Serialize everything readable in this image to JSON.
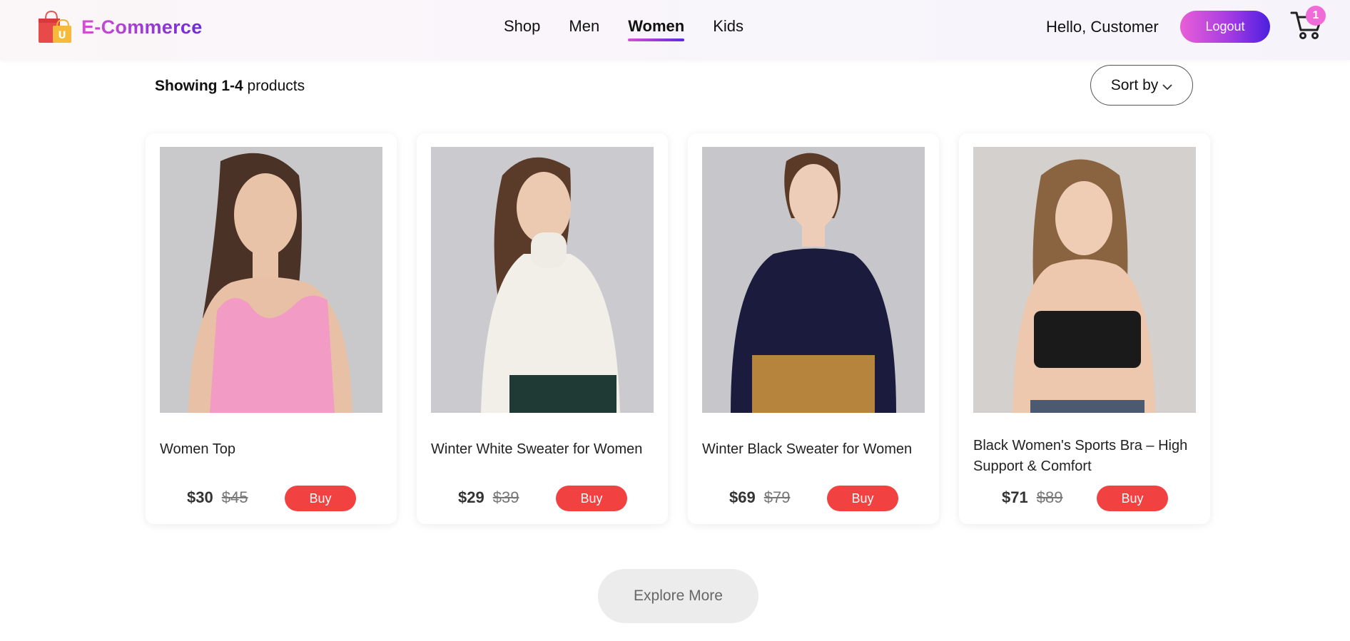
{
  "header": {
    "brand": "E-Commerce",
    "nav": [
      {
        "label": "Shop"
      },
      {
        "label": "Men"
      },
      {
        "label": "Women"
      },
      {
        "label": "Kids"
      }
    ],
    "active_nav": "Women",
    "greeting": "Hello, Customer",
    "logout_label": "Logout",
    "cart_count": "1"
  },
  "toolbar": {
    "showing_prefix": "Showing",
    "showing_range": "1-4",
    "showing_suffix": "products",
    "sort_label": "Sort by"
  },
  "products": [
    {
      "title": "Women Top",
      "price": "$30",
      "old_price": "$45",
      "buy_label": "Buy",
      "image": "woman-pink-top-photo"
    },
    {
      "title": "Winter White Sweater for Women",
      "price": "$29",
      "old_price": "$39",
      "buy_label": "Buy",
      "image": "woman-white-turtleneck-photo"
    },
    {
      "title": "Winter Black Sweater for Women",
      "price": "$69",
      "old_price": "$79",
      "buy_label": "Buy",
      "image": "woman-navy-sweater-photo"
    },
    {
      "title": "Black Women's Sports Bra – High Support & Comfort",
      "price": "$71",
      "old_price": "$89",
      "buy_label": "Buy",
      "image": "woman-black-sports-bra-photo"
    }
  ],
  "explore_label": "Explore More",
  "colors": {
    "brand_gradient_start": "#d64fd0",
    "brand_gradient_end": "#5b2ae0",
    "buy_button": "#f24141",
    "cart_badge": "#f16bd8"
  }
}
